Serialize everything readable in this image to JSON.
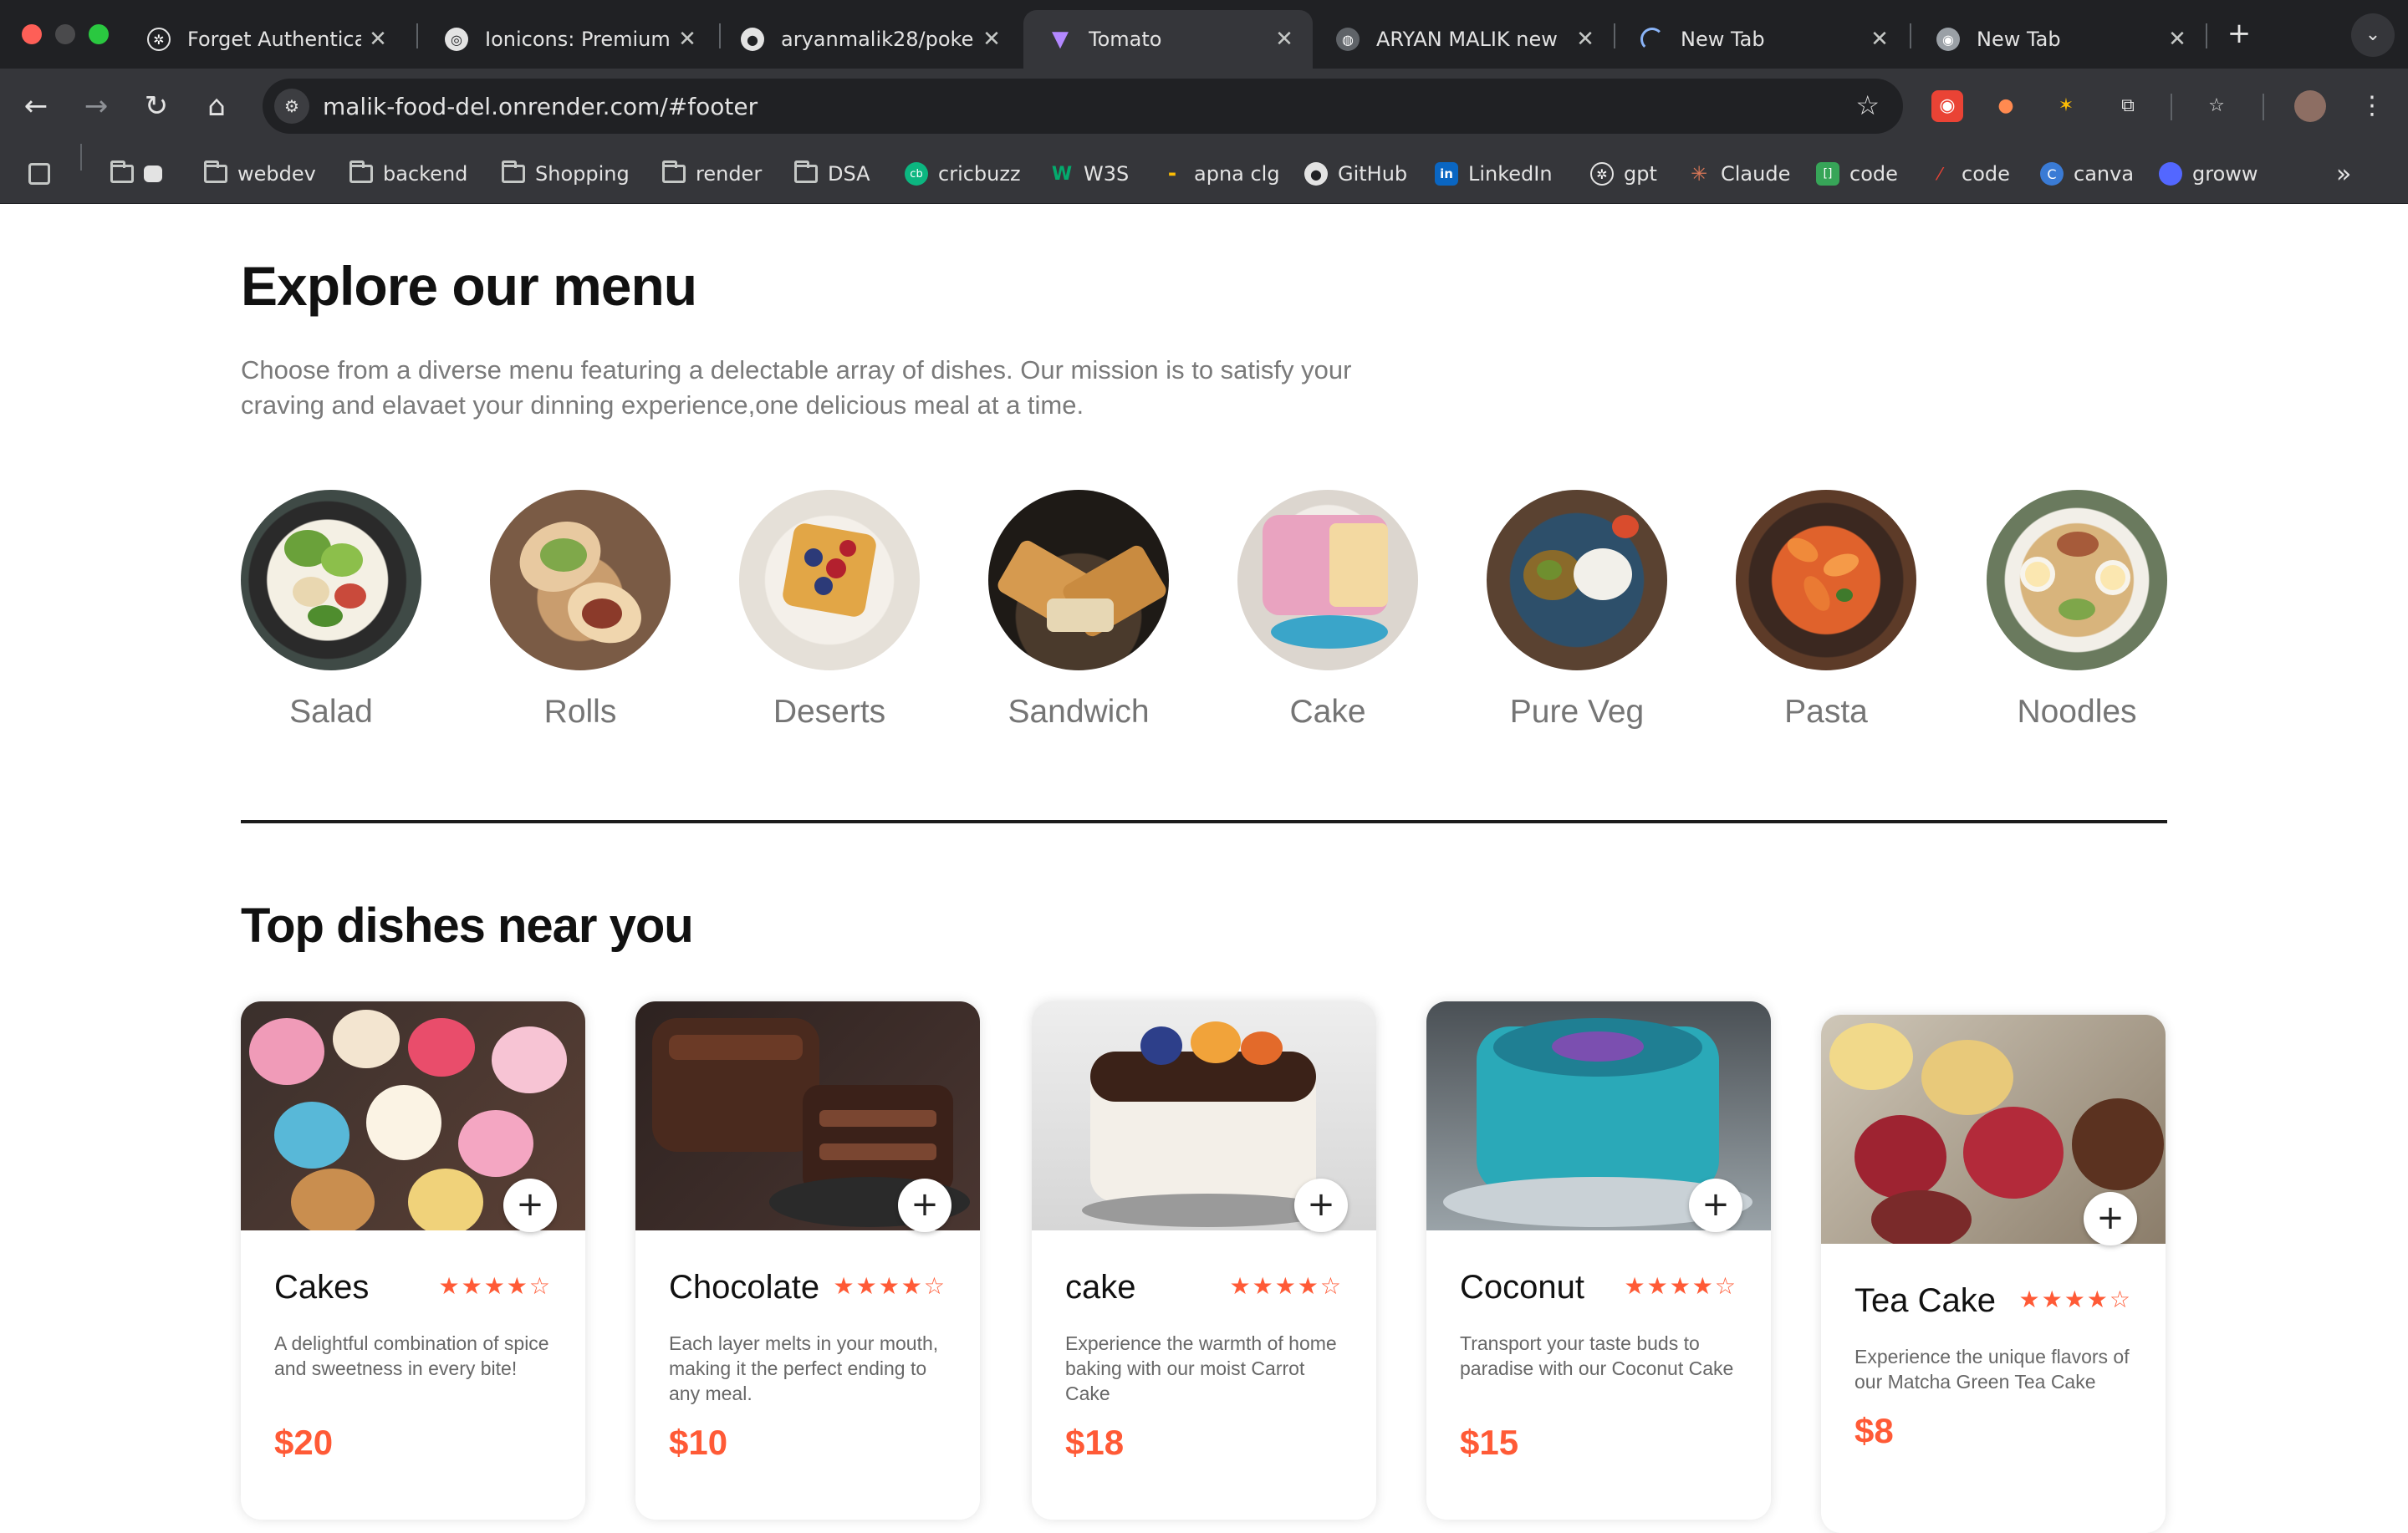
{
  "browser": {
    "tabs": [
      {
        "title": "Forget Authenticat",
        "active": false
      },
      {
        "title": "Ionicons: Premium",
        "active": false
      },
      {
        "title": "aryanmalik28/poke",
        "active": false
      },
      {
        "title": "Tomato",
        "active": true
      },
      {
        "title": "ARYAN MALIK new",
        "active": false
      },
      {
        "title": "New Tab",
        "active": false
      },
      {
        "title": "New Tab",
        "active": false
      }
    ],
    "new_tab": "+",
    "url": "malik-food-del.onrender.com/#footer",
    "bookmarks": [
      {
        "label": "",
        "icon": "folder-icon"
      },
      {
        "label": "webdev",
        "icon": "folder-icon"
      },
      {
        "label": "backend",
        "icon": "folder-icon"
      },
      {
        "label": "Shopping",
        "icon": "folder-icon"
      },
      {
        "label": "render",
        "icon": "folder-icon"
      },
      {
        "label": "DSA",
        "icon": "folder-icon"
      },
      {
        "label": "cricbuzz",
        "icon": "cricbuzz-icon"
      },
      {
        "label": "W3S",
        "icon": "w3schools-icon"
      },
      {
        "label": "apna clg",
        "icon": "apna-college-icon"
      },
      {
        "label": "GitHub",
        "icon": "github-icon"
      },
      {
        "label": "LinkedIn",
        "icon": "linkedin-icon"
      },
      {
        "label": "gpt",
        "icon": "openai-icon"
      },
      {
        "label": "Claude",
        "icon": "claude-icon"
      },
      {
        "label": "code",
        "icon": "code-icon"
      },
      {
        "label": "code",
        "icon": "code-icon"
      },
      {
        "label": "canva",
        "icon": "canva-icon"
      },
      {
        "label": "groww",
        "icon": "groww-icon"
      }
    ]
  },
  "menu": {
    "title": "Explore our menu",
    "description": "Choose from a diverse menu featuring a delectable array of dishes. Our mission is to satisfy your craving and elavaet your dinning experience,one delicious meal at a time.",
    "categories": [
      {
        "name": "Salad"
      },
      {
        "name": "Rolls"
      },
      {
        "name": "Deserts"
      },
      {
        "name": "Sandwich"
      },
      {
        "name": "Cake"
      },
      {
        "name": "Pure Veg"
      },
      {
        "name": "Pasta"
      },
      {
        "name": "Noodles"
      }
    ]
  },
  "dishes": {
    "title": "Top dishes near you",
    "items": [
      {
        "name": "Cakes",
        "rating": 4,
        "max_rating": 5,
        "stars": "★★★★☆",
        "description": "A delightful combination of spice and sweetness in every bite!",
        "price": "$20"
      },
      {
        "name": "Chocolate",
        "rating": 4,
        "max_rating": 5,
        "stars": "★★★★☆",
        "description": "Each layer melts in your mouth, making it the perfect ending to any meal.",
        "price": "$10"
      },
      {
        "name": "cake",
        "rating": 4,
        "max_rating": 5,
        "stars": "★★★★☆",
        "description": "Experience the warmth of home baking with our moist Carrot Cake",
        "price": "$18"
      },
      {
        "name": "Coconut",
        "rating": 4,
        "max_rating": 5,
        "stars": "★★★★☆",
        "description": "Transport your taste buds to paradise with our Coconut Cake",
        "price": "$15"
      },
      {
        "name": "Tea Cake",
        "rating": 4,
        "max_rating": 5,
        "stars": "★★★★☆",
        "description": "Experience the unique flavors of our Matcha Green Tea Cake",
        "price": "$8"
      }
    ],
    "add_button": "+"
  },
  "colors": {
    "accent": "#ff5a36",
    "tab_strip": "#202124",
    "toolbar": "#35363a"
  }
}
